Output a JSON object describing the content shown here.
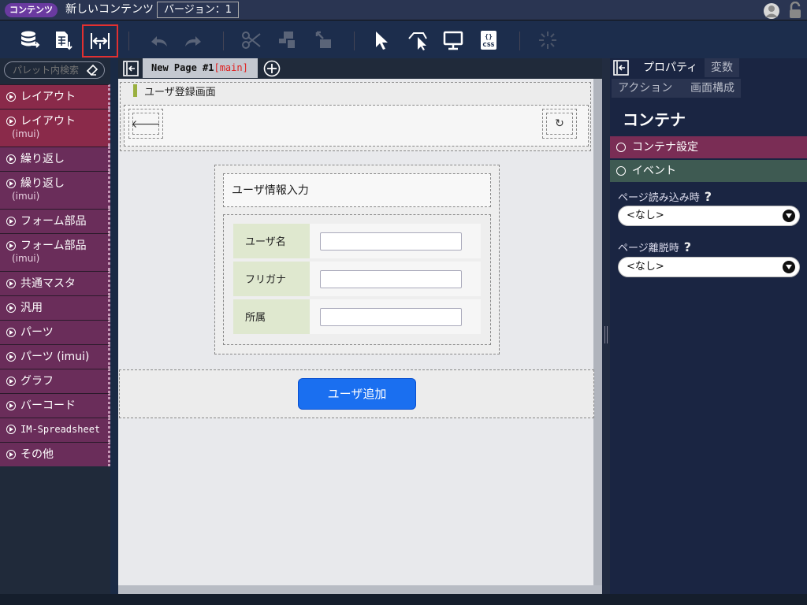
{
  "topbar": {
    "badge": "コンテンツ",
    "content_name": "新しいコンテンツ",
    "version": "バージョン：1"
  },
  "palette": {
    "search_placeholder": "パレット内検索",
    "items": [
      {
        "label": "レイアウト",
        "sub": ""
      },
      {
        "label": "レイアウト",
        "sub": "(imui)"
      },
      {
        "label": "繰り返し",
        "sub": ""
      },
      {
        "label": "繰り返し",
        "sub": "(imui)"
      },
      {
        "label": "フォーム部品",
        "sub": ""
      },
      {
        "label": "フォーム部品",
        "sub": "(imui)"
      },
      {
        "label": "共通マスタ",
        "sub": ""
      },
      {
        "label": "汎用",
        "sub": ""
      },
      {
        "label": "パーツ",
        "sub": ""
      },
      {
        "label": "パーツ (imui)",
        "sub": ""
      },
      {
        "label": "グラフ",
        "sub": ""
      },
      {
        "label": "バーコード",
        "sub": ""
      },
      {
        "label": "IM-Spreadsheet",
        "sub": ""
      },
      {
        "label": "その他",
        "sub": ""
      }
    ]
  },
  "editor": {
    "tab_name": "New Page #1",
    "tab_branch": "[main]"
  },
  "canvas": {
    "header_title": "ユーザ登録画面",
    "back_glyph": "🡐",
    "refresh_glyph": "↻",
    "form_title": "ユーザ情報入力",
    "rows": [
      {
        "label": "ユーザ名",
        "value": ""
      },
      {
        "label": "フリガナ",
        "value": ""
      },
      {
        "label": "所属",
        "value": ""
      }
    ],
    "add_button": "ユーザ追加"
  },
  "properties": {
    "tabs": [
      "プロパティ",
      "変数",
      "アクション",
      "画面構成"
    ],
    "heading": "コンテナ",
    "section_settings": "コンテナ設定",
    "section_events": "イベント",
    "on_load_label": "ページ読み込み時",
    "on_load_value": "<なし>",
    "on_leave_label": "ページ離脱時",
    "on_leave_value": "<なし>",
    "help": "?"
  },
  "colors": {
    "accent": "#1a6ff0",
    "palette_item": "#6a2d5a",
    "settings_section": "#7a2d55",
    "events_section": "#3e5a52",
    "highlight": "#e23030"
  }
}
